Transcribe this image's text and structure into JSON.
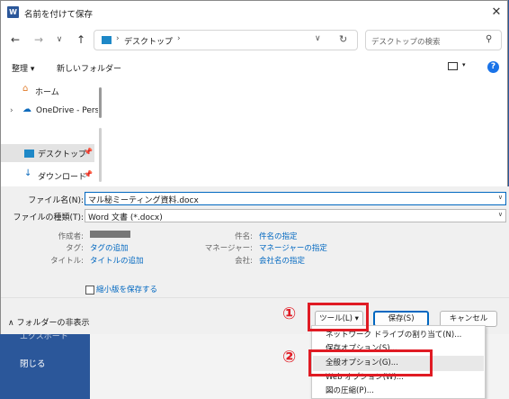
{
  "background": {
    "backstage_item": "エクスポート",
    "close_label": "閉じる"
  },
  "dialog": {
    "title": "名前を付けて保存",
    "app_icon": "W",
    "close_glyph": "✕"
  },
  "nav": {
    "back": "←",
    "forward": "→",
    "recent": "∨",
    "up": "↑",
    "address_path": "デスクトップ",
    "address_chevron": "›",
    "address_dropdown": "∨",
    "refresh": "↻",
    "search_placeholder": "デスクトップの検索",
    "search_icon": "⚲"
  },
  "toolbar": {
    "organize": "整理 ▾",
    "new_folder": "新しいフォルダー",
    "view_caret": "▾",
    "help": "?"
  },
  "sidebar": {
    "items": [
      {
        "label": "ホーム",
        "icon": "home-icon",
        "glyph": "⌂"
      },
      {
        "label": "OneDrive - Perso",
        "icon": "cloud-icon",
        "glyph": "☁",
        "expander": "›"
      },
      {
        "label": "デスクトップ",
        "icon": "desktop-folder-icon",
        "selected": true
      },
      {
        "label": "ダウンロード",
        "icon": "download-icon",
        "glyph": "↓"
      }
    ],
    "pin_glyph": "📌"
  },
  "form": {
    "filename_label": "ファイル名(N):",
    "filename_value": "マル秘ミーティング資料.docx",
    "filetype_label": "ファイルの種類(T):",
    "filetype_value": "Word 文書 (*.docx)",
    "caret": "∨"
  },
  "metadata": {
    "author_label": "作成者:",
    "tags_label": "タグ:",
    "tags_value": "タグの追加",
    "title_label": "タイトル:",
    "title_value": "タイトルの追加",
    "subject_label": "件名:",
    "subject_value": "件名の指定",
    "manager_label": "マネージャー:",
    "manager_value": "マネージャーの指定",
    "company_label": "会社:",
    "company_value": "会社名の指定",
    "thumbnail_label": "縮小版を保存する"
  },
  "footer": {
    "hide_folders": "フォルダーの非表示",
    "hide_caret": "∧",
    "tools": "ツール(L) ▾",
    "save": "保存(S)",
    "cancel": "キャンセル"
  },
  "tools_menu": [
    "ネットワーク ドライブの割り当て(N)...",
    "保存オプション(S)...",
    "全般オプション(G)...",
    "Web オプション(W)...",
    "図の圧縮(P)..."
  ],
  "annotations": {
    "marker1": "①",
    "marker2": "②",
    "color": "#e01b24"
  }
}
